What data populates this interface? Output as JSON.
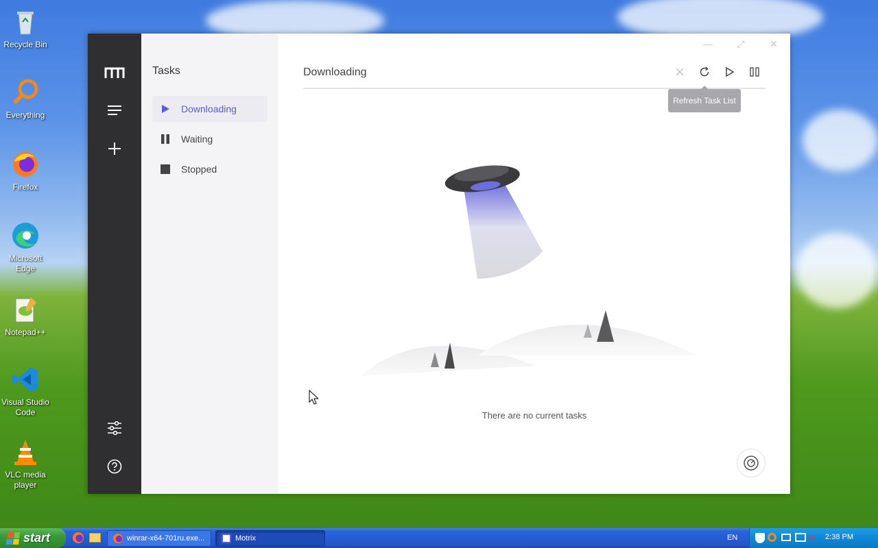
{
  "desktop": {
    "icons": [
      {
        "label": "Recycle Bin"
      },
      {
        "label": "Everything"
      },
      {
        "label": "Firefox"
      },
      {
        "label": "Microsoft Edge"
      },
      {
        "label": "Notepad++"
      },
      {
        "label": "Visual Studio Code"
      },
      {
        "label": "VLC media player"
      }
    ]
  },
  "app": {
    "window_controls": {
      "minimize": "—",
      "maximize": "⤢",
      "close": "✕"
    },
    "sidebar": {
      "title": "Tasks",
      "items": [
        {
          "label": "Downloading",
          "icon": "play-icon",
          "active": true
        },
        {
          "label": "Waiting",
          "icon": "pause-icon",
          "active": false
        },
        {
          "label": "Stopped",
          "icon": "stop-icon",
          "active": false
        }
      ]
    },
    "main": {
      "title": "Downloading",
      "tooltip": "Refresh Task List",
      "empty_text": "There are no current tasks"
    },
    "colors": {
      "accent": "#5b5bd6",
      "rail": "#2f2f31",
      "sidebar": "#f4f4f6"
    }
  },
  "taskbar": {
    "start_label": "start",
    "tasks": [
      {
        "label": "winrar-x64-701ru.exe..."
      },
      {
        "label": "Motrix"
      }
    ],
    "language": "EN",
    "clock": "2:38 PM"
  }
}
